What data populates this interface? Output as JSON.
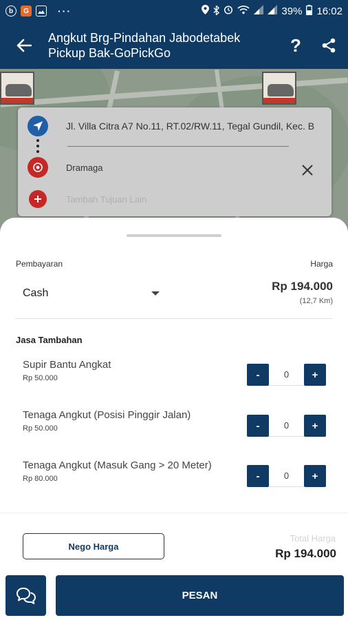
{
  "status_bar": {
    "battery_percent": "39%",
    "time": "16:02",
    "more_indicator": "···",
    "notification_icons": [
      "b-circle-icon",
      "orange-app-icon",
      "image-icon"
    ],
    "system_icons": [
      "location-icon",
      "bluetooth-icon",
      "alarm-icon",
      "wifi-icon",
      "signal-icon",
      "signal-icon",
      "battery-icon"
    ]
  },
  "app_bar": {
    "title_line1": "Angkut Brg-Pindahan Jabodetabek",
    "title_line2": "Pickup Bak-GoPickGo",
    "icons": [
      "back-arrow-icon",
      "help-icon",
      "share-icon"
    ]
  },
  "route": {
    "origin": "Jl. Villa Citra A7 No.11, RT.02/RW.11, Tegal Gundil, Kec. B",
    "destination": "Dramaga",
    "add_destination_placeholder": "Tambah Tujuan Lain"
  },
  "payment": {
    "label": "Pembayaran",
    "selected": "Cash",
    "price_label": "Harga",
    "price": "Rp 194.000",
    "distance": "(12,7 Km)"
  },
  "extras": {
    "title": "Jasa Tambahan",
    "items": [
      {
        "name": "Supir Bantu Angkat",
        "price": "Rp 50.000",
        "qty": "0"
      },
      {
        "name": "Tenaga Angkut (Posisi Pinggir Jalan)",
        "price": "Rp 50.000",
        "qty": "0"
      },
      {
        "name": "Tenaga Angkut (Masuk Gang > 20 Meter)",
        "price": "Rp 80.000",
        "qty": "0"
      }
    ],
    "minus_label": "-",
    "plus_label": "+"
  },
  "footer": {
    "nego_label": "Nego Harga",
    "total_label": "Total Harga",
    "total_value": "Rp 194.000",
    "order_label": "PESAN"
  },
  "colors": {
    "primary": "#0f3a63",
    "destination_red": "#c62828",
    "origin_blue": "#1e5fa8"
  }
}
